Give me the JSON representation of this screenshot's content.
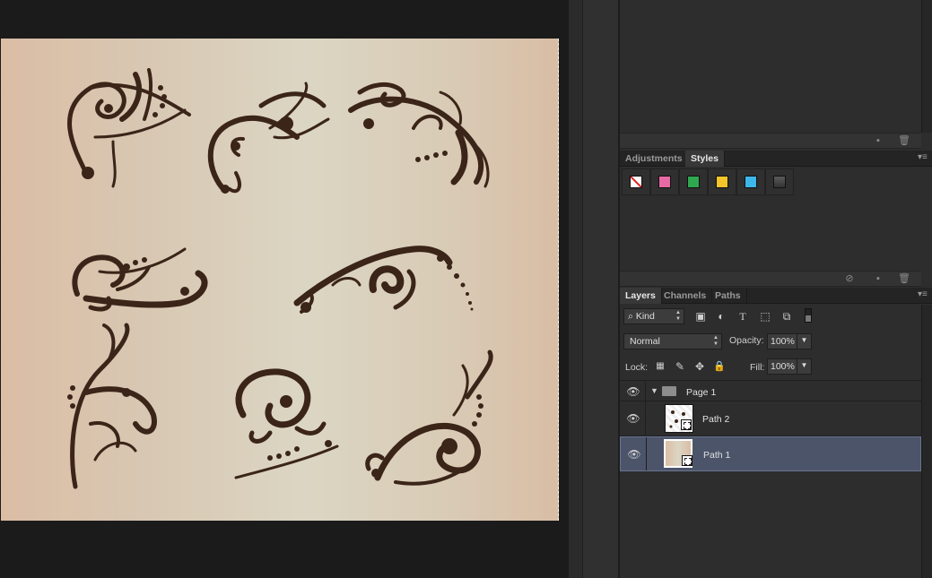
{
  "styles_panel": {
    "tabs": [
      "Adjustments",
      "Styles"
    ],
    "active_tab": "Styles",
    "swatches": [
      {
        "name": "none",
        "color": "#ffffff"
      },
      {
        "name": "pink",
        "color": "#e86aa4"
      },
      {
        "name": "green",
        "color": "#2fa84f"
      },
      {
        "name": "yellow",
        "color": "#f3c52b"
      },
      {
        "name": "cyan",
        "color": "#3db7ea"
      },
      {
        "name": "dark-gray",
        "color": "#4a4a4a"
      }
    ]
  },
  "layers_panel": {
    "tabs": [
      "Layers",
      "Channels",
      "Paths"
    ],
    "active_tab": "Layers",
    "filter_kind": "Kind",
    "blend_mode": "Normal",
    "opacity_label": "Opacity:",
    "opacity_value": "100%",
    "lock_label": "Lock:",
    "fill_label": "Fill:",
    "fill_value": "100%",
    "layers": [
      {
        "name": "Page 1",
        "type": "group",
        "expanded": true
      },
      {
        "name": "Path 2",
        "type": "layer"
      },
      {
        "name": "Path 1",
        "type": "layer",
        "selected": true
      }
    ]
  },
  "icons": {
    "eye": "eye-icon",
    "folder": "folder-icon",
    "new_layer": "new-layer-icon",
    "trash": "trash-icon",
    "panel_menu": "panel-menu-icon"
  },
  "colors": {
    "ornament": "#3b2418",
    "selected_row": "#4b5469",
    "panel_bg": "#2d2d2d"
  }
}
